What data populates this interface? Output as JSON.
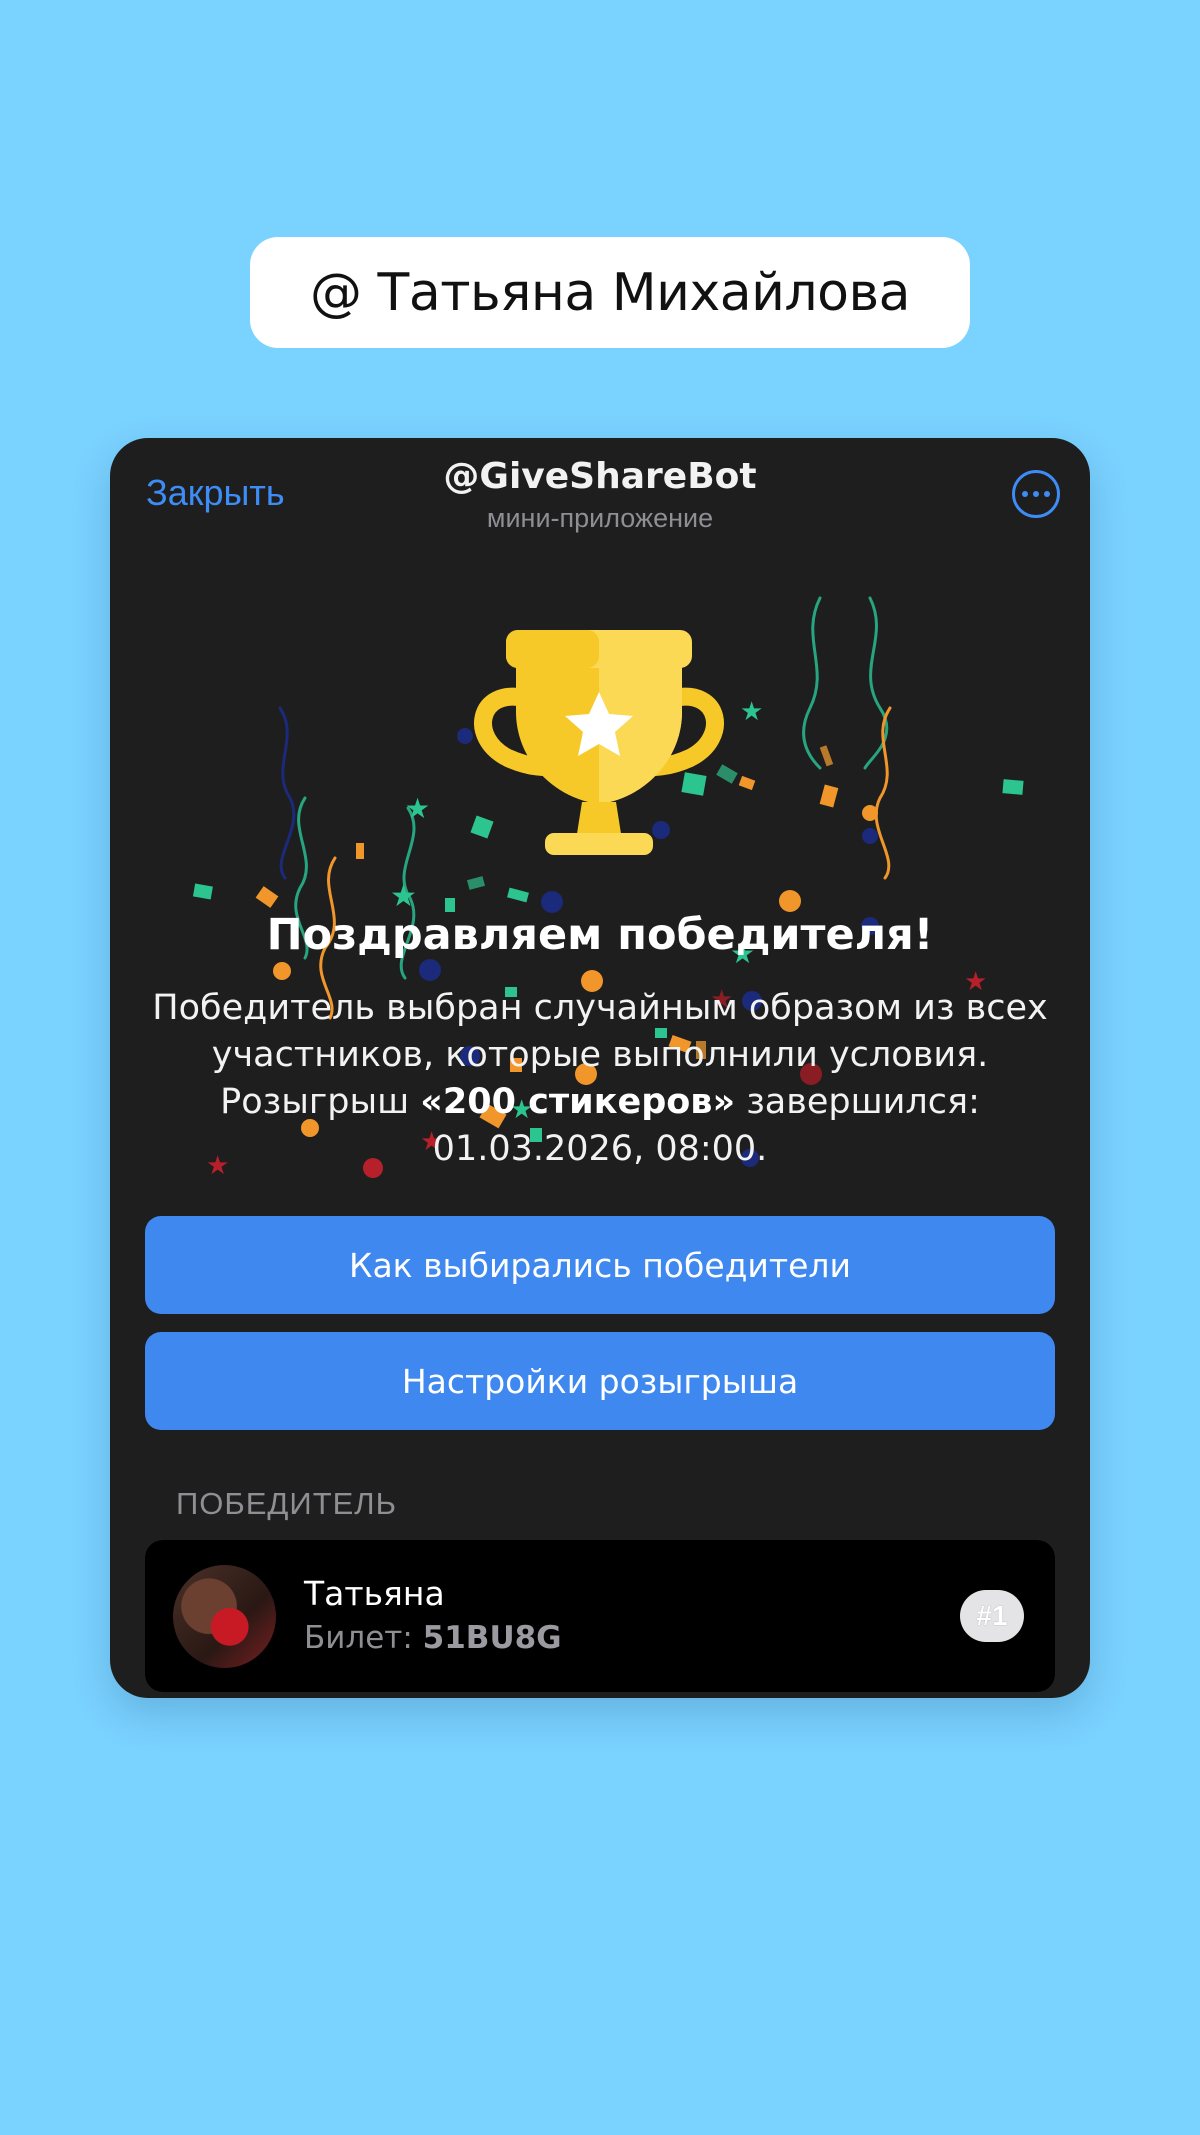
{
  "user_label": "@ Татьяна Михайлова",
  "header": {
    "close_label": "Закрыть",
    "bot_name": "@GiveShareBot",
    "bot_subtitle": "мини-приложение",
    "menu_icon": "more-dots-icon"
  },
  "result": {
    "title": "Поздравляем победителя!",
    "text_part1": "Победитель выбран случайным образом из всех участников, которые выполнили условия. Розыгрыш ",
    "giveaway_name": "«200 стикеров»",
    "text_part2": " завершился: 01.03.2026, 08:00."
  },
  "buttons": {
    "how_selected": "Как выбирались победители",
    "settings": "Настройки розыгрыша"
  },
  "winners": {
    "section_label": "ПОБЕДИТЕЛЬ",
    "items": [
      {
        "name": "Татьяна",
        "ticket_label": "Билет: ",
        "ticket_code": "51BU8G",
        "rank": "#1"
      }
    ]
  },
  "colors": {
    "background": "#7ad2ff",
    "card": "#1e1e1f",
    "accent": "#3f88f0",
    "trophy": "#f7c928"
  }
}
